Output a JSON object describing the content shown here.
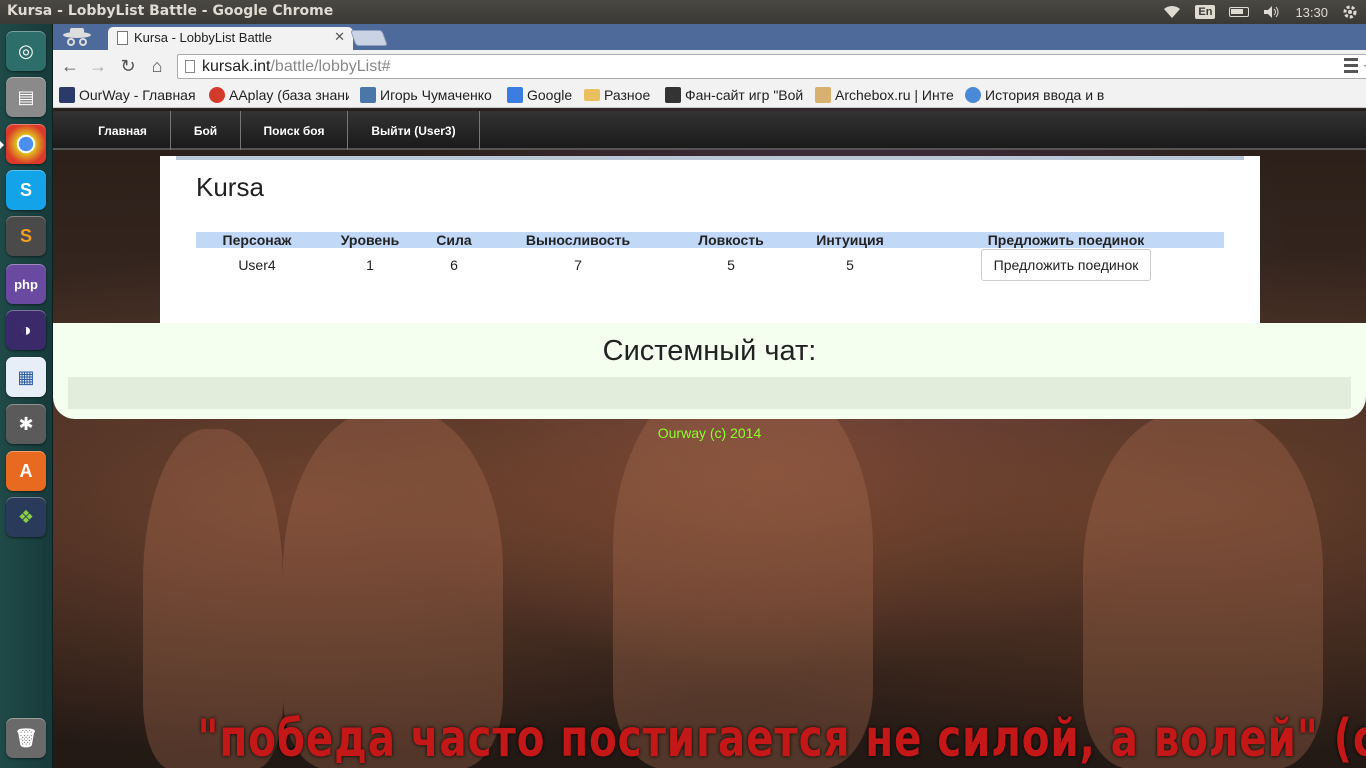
{
  "os": {
    "window_title": "Kursa - LobbyList Battle - Google Chrome",
    "keyboard_layout": "En",
    "clock": "13:30"
  },
  "launcher": {
    "icons": [
      "ubuntu-dash-icon",
      "files-icon",
      "chrome-icon",
      "skype-icon",
      "sublime-text-icon",
      "phpstorm-icon",
      "eclipse-icon",
      "libreoffice-writer-icon",
      "system-settings-icon",
      "software-center-icon",
      "windows-icon",
      "trash-icon"
    ]
  },
  "browser": {
    "tab_title": "Kursa - LobbyList Battle",
    "url_host": "kursak.int",
    "url_path": "/battle/lobbyList#",
    "bookmarks": [
      {
        "label": "OurWay - Главная с",
        "color": "#2a3a6a"
      },
      {
        "label": "AAplay (база знани",
        "color": "#d23a2a"
      },
      {
        "label": "Игорь Чумаченко",
        "color": "#4a76a8"
      },
      {
        "label": "Google",
        "color": "#3b7de0"
      },
      {
        "label": "Разное",
        "color": "#e8c060"
      },
      {
        "label": "Фан-сайт игр \"Вой",
        "color": "#333333"
      },
      {
        "label": "Archebox.ru | Инте",
        "color": "#d8b070"
      },
      {
        "label": "История ввода и в",
        "color": "#4a88d8"
      }
    ]
  },
  "site": {
    "nav": [
      "Главная",
      "Бой",
      "Поиск боя",
      "Выйти (User3)"
    ],
    "title": "Kursa",
    "table": {
      "headers": [
        "Персонаж",
        "Уровень",
        "Сила",
        "Выносливость",
        "Ловкость",
        "Интуиция",
        "Предложить поединок"
      ],
      "rows": [
        {
          "name": "User4",
          "level": "1",
          "strength": "6",
          "stamina": "7",
          "agility": "5",
          "intuition": "5",
          "action": "Предложить поединок"
        }
      ]
    },
    "chat_title": "Системный чат:",
    "footer": "Ourway (c) 2014",
    "quote": "\"победа часто постигается не силой, а волей\" (спартак)"
  }
}
